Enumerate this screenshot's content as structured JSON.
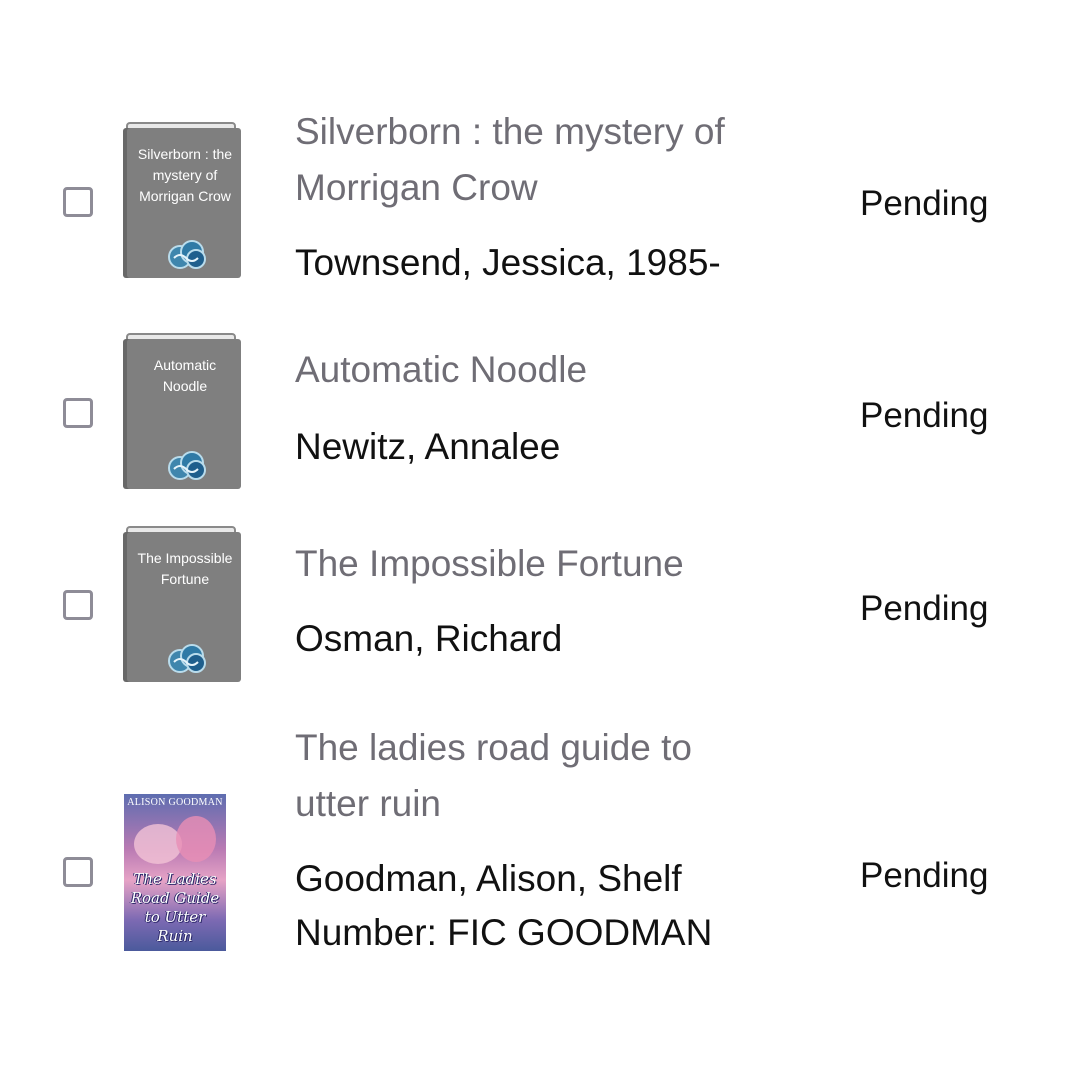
{
  "holds": [
    {
      "title": "Silverborn : the mystery of Morrigan Crow",
      "author": "Townsend, Jessica, 1985-",
      "cover_text": "Silverborn : the mystery of Morrigan Crow",
      "status": "Pending",
      "cover_type": "placeholder-book-icon"
    },
    {
      "title": "Automatic Noodle",
      "author": "Newitz, Annalee",
      "cover_text": "Automatic Noodle",
      "status": "Pending",
      "cover_type": "placeholder-book-icon"
    },
    {
      "title": "The Impossible Fortune",
      "author": "Osman, Richard",
      "cover_text": "The Impossible Fortune",
      "status": "Pending",
      "cover_type": "placeholder-book-icon"
    },
    {
      "title": "The ladies road guide to utter ruin",
      "author": "Goodman, Alison, Shelf Number: FIC GOODMAN",
      "cover_author": "ALISON GOODMAN",
      "cover_title": "The Ladies Road Guide to Utter Ruin",
      "status": "Pending",
      "cover_type": "book-cover-image"
    }
  ]
}
